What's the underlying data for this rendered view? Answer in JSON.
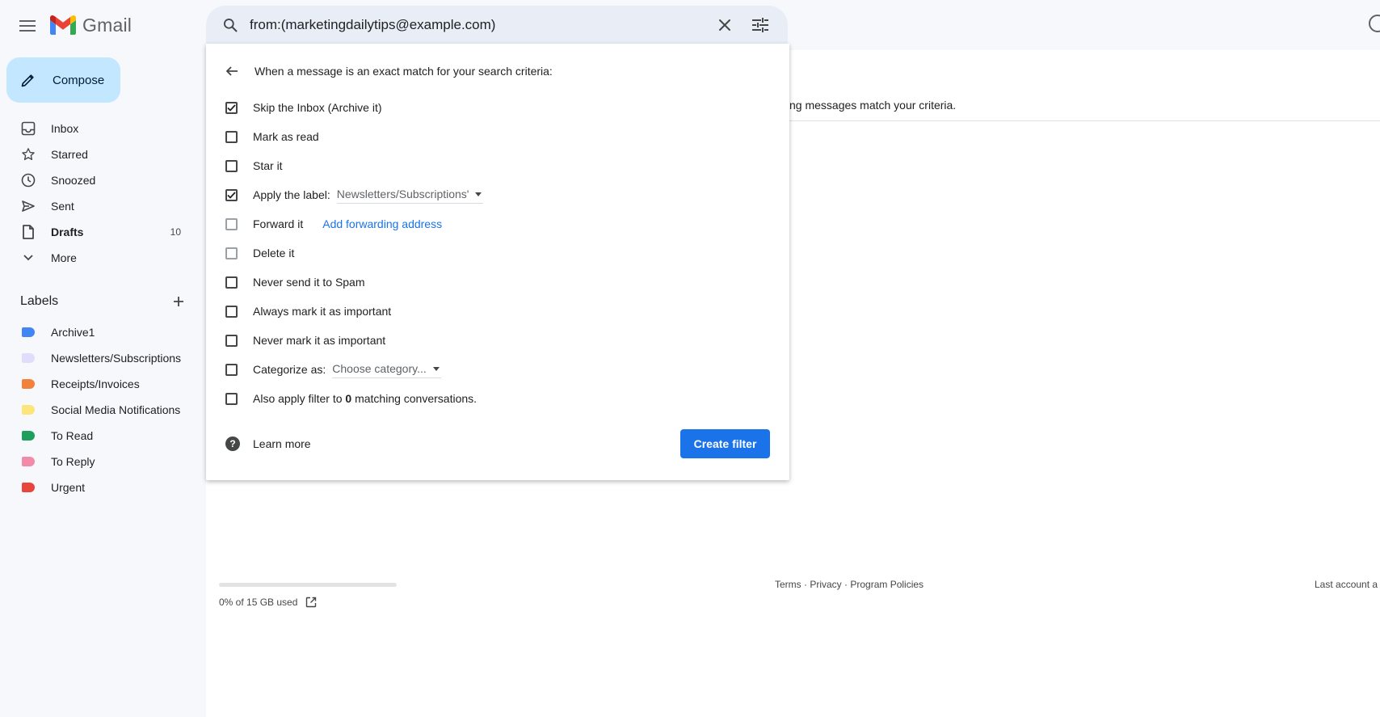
{
  "app": {
    "name": "Gmail"
  },
  "search": {
    "value": "from:(marketingdailytips@example.com)"
  },
  "sidebar": {
    "compose_label": "Compose",
    "items": [
      {
        "label": "Inbox",
        "icon": "inbox-icon",
        "count": ""
      },
      {
        "label": "Starred",
        "icon": "star-icon",
        "count": ""
      },
      {
        "label": "Snoozed",
        "icon": "clock-icon",
        "count": ""
      },
      {
        "label": "Sent",
        "icon": "send-icon",
        "count": ""
      },
      {
        "label": "Drafts",
        "icon": "file-icon",
        "count": "10"
      },
      {
        "label": "More",
        "icon": "chevron-down-icon",
        "count": ""
      }
    ],
    "labels_title": "Labels",
    "labels": [
      {
        "label": "Archive1",
        "color": "#4285f4"
      },
      {
        "label": "Newsletters/Subscriptions",
        "color": "#e1dcfb"
      },
      {
        "label": "Receipts/Invoices",
        "color": "#f2813b"
      },
      {
        "label": "Social Media Notifications",
        "color": "#fce57a"
      },
      {
        "label": "To Read",
        "color": "#1e9f5b"
      },
      {
        "label": "To Reply",
        "color": "#f28aa9"
      },
      {
        "label": "Urgent",
        "color": "#e8453c"
      }
    ]
  },
  "filter": {
    "title": "When a message is an exact match for your search criteria:",
    "options": {
      "skip_inbox": {
        "label": "Skip the Inbox (Archive it)",
        "checked": true
      },
      "mark_read": {
        "label": "Mark as read",
        "checked": false
      },
      "star": {
        "label": "Star it",
        "checked": false
      },
      "apply_label": {
        "label": "Apply the label:",
        "checked": true,
        "value": "Newsletters/Subscriptions'"
      },
      "forward": {
        "label": "Forward it",
        "checked": false,
        "link": "Add forwarding address"
      },
      "delete": {
        "label": "Delete it",
        "checked": false
      },
      "never_spam": {
        "label": "Never send it to Spam",
        "checked": false
      },
      "always_important": {
        "label": "Always mark it as important",
        "checked": false
      },
      "never_important": {
        "label": "Never mark it as important",
        "checked": false
      },
      "categorize": {
        "label": "Categorize as:",
        "checked": false,
        "value": "Choose category..."
      },
      "also_apply": {
        "prefix": "Also apply filter to",
        "count": "0",
        "suffix": "matching conversations.",
        "checked": false
      }
    },
    "learn_more": "Learn more",
    "create_button": "Create filter"
  },
  "main": {
    "message_fragment": "ng messages match your criteria.",
    "storage_text": "0% of 15 GB used",
    "storage_fraction": 0.0,
    "footer": {
      "terms": "Terms",
      "privacy": "Privacy",
      "policies": "Program Policies",
      "sep": " · "
    },
    "last_activity": "Last account a"
  }
}
